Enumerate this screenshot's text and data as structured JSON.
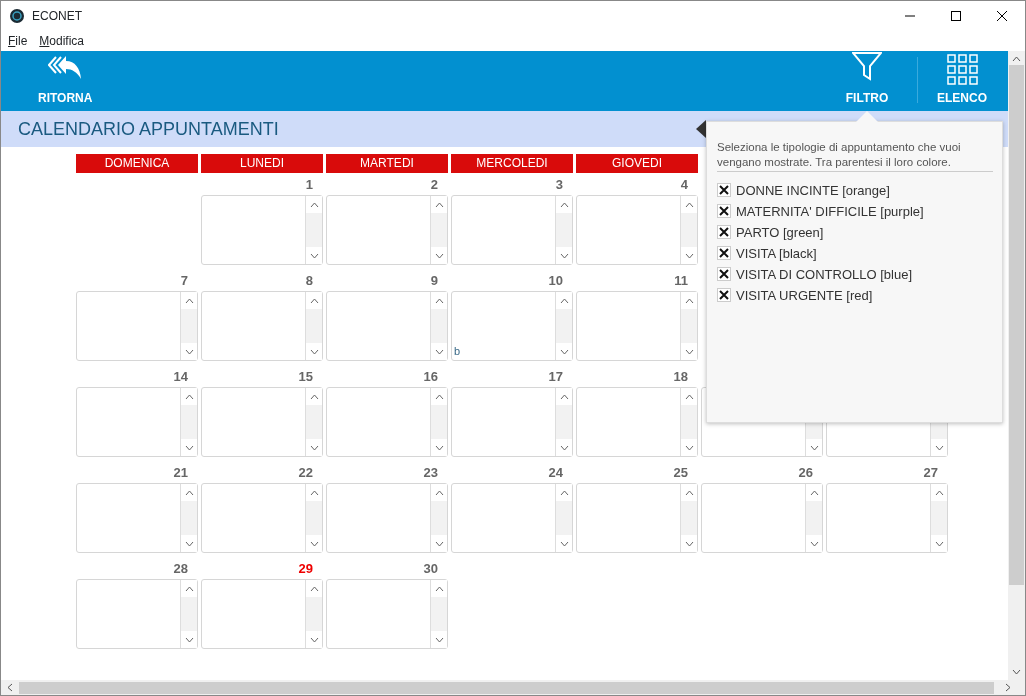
{
  "window": {
    "title": "ECONET"
  },
  "menu": [
    "File",
    "Modifica"
  ],
  "toolbar": {
    "back": "RITORNA",
    "filter": "FILTRO",
    "list": "ELENCO"
  },
  "page_title": "CALENDARIO APPUNTAMENTI",
  "weekdays": [
    "DOMENICA",
    "LUNEDI",
    "MARTEDI",
    "MERCOLEDI",
    "GIOVEDI"
  ],
  "weeks": [
    [
      {
        "kind": "blank"
      },
      {
        "kind": "day",
        "day": "1",
        "today": false
      },
      {
        "kind": "day",
        "day": "2",
        "today": false
      },
      {
        "kind": "day",
        "day": "3",
        "today": false
      },
      {
        "kind": "day",
        "day": "4",
        "today": false
      },
      {
        "kind": "hidden"
      },
      {
        "kind": "hidden"
      }
    ],
    [
      {
        "kind": "day",
        "day": "7",
        "today": false
      },
      {
        "kind": "day",
        "day": "8",
        "today": false
      },
      {
        "kind": "day",
        "day": "9",
        "today": false
      },
      {
        "kind": "day",
        "day": "10",
        "today": false,
        "entries": [
          "b"
        ]
      },
      {
        "kind": "day",
        "day": "11",
        "today": false
      },
      {
        "kind": "hidden"
      },
      {
        "kind": "hidden"
      }
    ],
    [
      {
        "kind": "day",
        "day": "14",
        "today": false
      },
      {
        "kind": "day",
        "day": "15",
        "today": false
      },
      {
        "kind": "day",
        "day": "16",
        "today": false
      },
      {
        "kind": "day",
        "day": "17",
        "today": false
      },
      {
        "kind": "day",
        "day": "18",
        "today": false
      },
      {
        "kind": "covered"
      },
      {
        "kind": "covered"
      }
    ],
    [
      {
        "kind": "day",
        "day": "21",
        "today": false
      },
      {
        "kind": "day",
        "day": "22",
        "today": false
      },
      {
        "kind": "day",
        "day": "23",
        "today": false
      },
      {
        "kind": "day",
        "day": "24",
        "today": false
      },
      {
        "kind": "day",
        "day": "25",
        "today": false
      },
      {
        "kind": "day",
        "day": "26",
        "today": false
      },
      {
        "kind": "day",
        "day": "27",
        "today": false
      }
    ],
    [
      {
        "kind": "day",
        "day": "28",
        "today": false
      },
      {
        "kind": "day",
        "day": "29",
        "today": true
      },
      {
        "kind": "day",
        "day": "30",
        "today": false
      },
      {
        "kind": "blank"
      },
      {
        "kind": "blank"
      },
      {
        "kind": "blank"
      },
      {
        "kind": "blank"
      }
    ]
  ],
  "filter_popover": {
    "hint": "Seleziona le tipologie di appuntamento che vuoi vengano mostrate. Tra parentesi il loro colore.",
    "options": [
      {
        "label": "DONNE INCINTE [orange]",
        "checked": true
      },
      {
        "label": "MATERNITA' DIFFICILE [purple]",
        "checked": true
      },
      {
        "label": "PARTO [green]",
        "checked": true
      },
      {
        "label": "VISITA [black]",
        "checked": true
      },
      {
        "label": "VISITA DI CONTROLLO [blue]",
        "checked": true
      },
      {
        "label": "VISITA URGENTE [red]",
        "checked": true
      }
    ]
  }
}
